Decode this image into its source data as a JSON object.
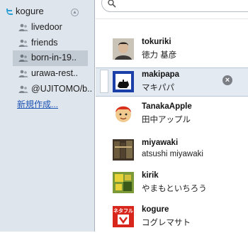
{
  "account": {
    "name": "kogure",
    "collapse_glyph": "▲"
  },
  "sidebar": {
    "items": [
      {
        "label": "livedoor"
      },
      {
        "label": "friends"
      },
      {
        "label": "born-in-19.."
      },
      {
        "label": "urawa-rest.."
      },
      {
        "label": "@UJITOMO/b.."
      }
    ],
    "selected_index": 2,
    "new_link": "新規作成..."
  },
  "search": {
    "icon": "search-icon",
    "value": ""
  },
  "users": [
    {
      "username": "tokuriki",
      "fullname": "徳力 基彦"
    },
    {
      "username": "makipapa",
      "fullname": "マキパパ",
      "selected": true
    },
    {
      "username": "TanakaApple",
      "fullname": "田中アップル"
    },
    {
      "username": "miyawaki",
      "fullname": "atsushi miyawaki"
    },
    {
      "username": "kirik",
      "fullname": "やまもといちろう"
    },
    {
      "username": "kogure",
      "fullname": "コグレマサト",
      "avatar_text": "ネタフル"
    }
  ],
  "colors": {
    "sidebar_bg": "#dfe5ec",
    "link": "#1f55b5",
    "selected_row": "#e3eaf2"
  }
}
